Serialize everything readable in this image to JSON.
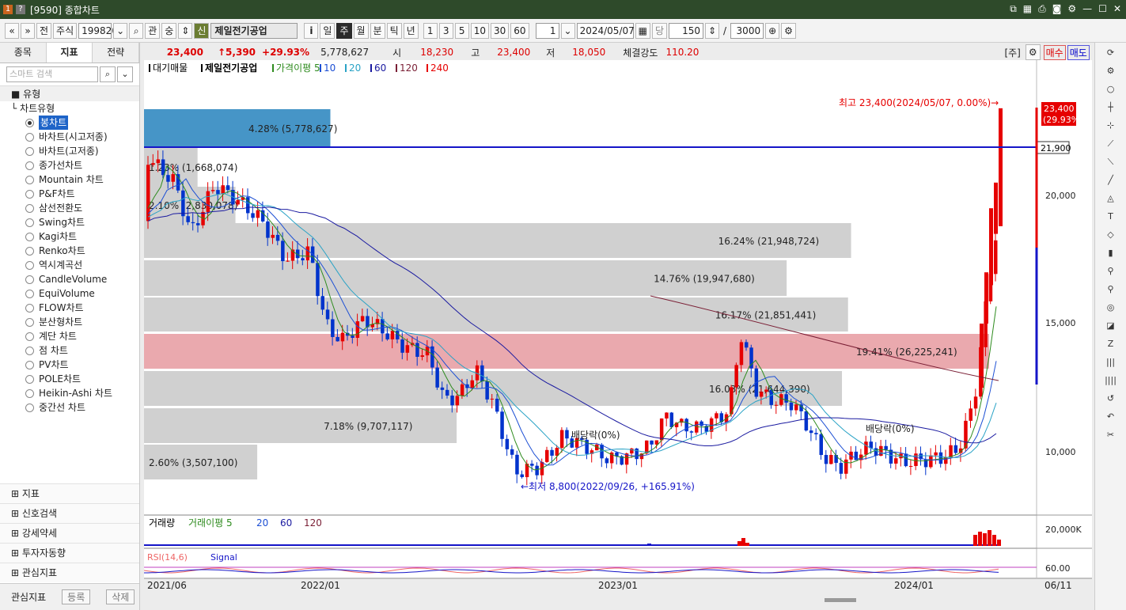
{
  "window": {
    "badge": "1",
    "help": "?",
    "title": "[9590] 종합차트"
  },
  "toolbar": {
    "items": [
      "«",
      "»",
      "전",
      "주식",
      "199820",
      "⌄",
      "🔍",
      "관",
      "숭",
      "⇕",
      "신"
    ],
    "stock_name": "제일전기공업",
    "info": "i",
    "periods": [
      "일",
      "주",
      "월",
      "분",
      "틱",
      "년"
    ],
    "active_period": "주",
    "numbers": [
      "1",
      "3",
      "5",
      "10",
      "30",
      "60"
    ],
    "count": "1",
    "date": "2024/05/07",
    "dang": "당",
    "bars": "150",
    "total": "3000"
  },
  "left_tabs": [
    "종목",
    "지표",
    "전략"
  ],
  "search_placeholder": "스마트 검색",
  "tree": {
    "section": "유형",
    "group": "차트유형",
    "items": [
      "봉차트",
      "바차트(시고저종)",
      "바차트(고저종)",
      "종가선차트",
      "Mountain 차트",
      "P&F차트",
      "삼선전환도",
      "Swing차트",
      "Kagi차트",
      "Renko차트",
      "역시계곡선",
      "CandleVolume",
      "EquiVolume",
      "FLOW차트",
      "분산형차트",
      "계단 차트",
      "점 차트",
      "PV차트",
      "POLE차트",
      "Heikin-Ashi 차트",
      "중간선 차트"
    ],
    "selected": 0
  },
  "bottom_sections": [
    "지표",
    "신호검색",
    "강세약세",
    "투자자동향",
    "관심지표"
  ],
  "fav": {
    "label": "관심지표",
    "add": "등록",
    "del": "삭제"
  },
  "quote": {
    "price": "23,400",
    "change": "↑5,390",
    "pct": "+29.93%",
    "volume": "5,778,627",
    "open_label": "시",
    "open": "18,230",
    "high_label": "고",
    "high": "23,400",
    "low_label": "저",
    "low": "18,050",
    "strength_label": "체결강도",
    "strength": "110.20",
    "unit": "[주]",
    "buy": "매수",
    "sell": "매도"
  },
  "legend": {
    "items": [
      "대기매물",
      "제일전기공업",
      "가격이평 5",
      "10",
      "20",
      "60",
      "120",
      "240"
    ]
  },
  "chart_data": {
    "type": "candlestick",
    "y_axis_ticks": [
      "20,000",
      "15,000",
      "10,000"
    ],
    "current_price_label": "23,400",
    "current_pct_label": "(29.93%)",
    "hline_label": "21,900",
    "max_label": "최고 23,400(2024/05/07, 0.00%)→",
    "min_label": "←최저 8,800(2022/09/26, +165.91%)",
    "dividend_labels": [
      "배당락(0%)",
      "배당락(0%)"
    ],
    "x_ticks": [
      "2021/06",
      "2022/01",
      "2023/01",
      "2024/01",
      "06/11"
    ],
    "volume_profile": [
      {
        "label": "4.28% (5,778,627)"
      },
      {
        "label": "1.23% (1,668,074)"
      },
      {
        "label": "2.10% (2,830,078)"
      },
      {
        "label": "16.24% (21,948,724)"
      },
      {
        "label": "14.76% (19,947,680)"
      },
      {
        "label": "16.17% (21,851,441)"
      },
      {
        "label": "19.41% (26,225,241)"
      },
      {
        "label": "16.03% (21,644,390)"
      },
      {
        "label": "7.18% (9,707,117)"
      },
      {
        "label": "2.60% (3,507,100)"
      }
    ],
    "volume_legend": [
      "거래량",
      "거래이평 5",
      "20",
      "60",
      "120"
    ],
    "volume_tick": "20,000K",
    "rsi_legend": [
      "RSI(14,6)",
      "Signal"
    ],
    "rsi_tick": "60.00"
  }
}
